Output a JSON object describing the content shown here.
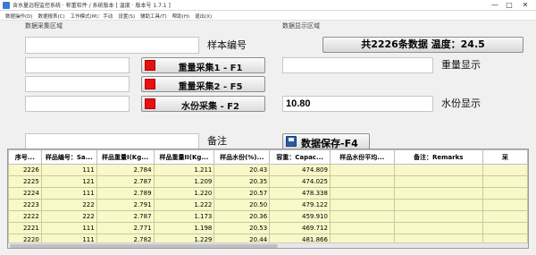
{
  "window": {
    "title": "含水量远程监控系统 · 称重软件 / 系统版本 [ 温度 · 版本号 1.7.1 ]",
    "minimize": "—",
    "maximize": "□",
    "close": "✕"
  },
  "menu": [
    "数据操作(D)",
    "数据报表(C)",
    "工作模式(M)：手动",
    "设置(S)",
    "辅助工具(T)",
    "帮助(H)",
    "退出(X)"
  ],
  "groups": {
    "acquisition": "数据采集区域",
    "display": "数据显示区域"
  },
  "form": {
    "sample_no_label": "样本编号",
    "sample_no_value": "",
    "weight1_value": "",
    "weight2_value": "",
    "moisture_value": "",
    "weight_display_label": "重量显示",
    "weight_display_value": "",
    "moisture_display_label": "水份显示",
    "moisture_display_value": "10.80",
    "remark_label": "备注",
    "remark_value": ""
  },
  "buttons": {
    "weigh1": "重量采集1 - F1",
    "weigh2": "重量采集2 - F5",
    "moisture": "水份采集 - F2",
    "save": "数据保存-F4"
  },
  "status": {
    "count_banner": "共2226条数据 温度：24.5"
  },
  "table": {
    "headers": [
      "序号...",
      "样品编号：Sa...",
      "样品重量I(Kg...",
      "样品重量II(Kg...",
      "样品水份(%)...",
      "容重：Capac...",
      "样品水份平均...",
      "备注：Remarks",
      "采"
    ],
    "rows": [
      [
        "2226",
        "111",
        "2.784",
        "1.211",
        "20.43",
        "474.809",
        "",
        "",
        ""
      ],
      [
        "2225",
        "121",
        "2.787",
        "1.209",
        "20.35",
        "474.025",
        "",
        "",
        ""
      ],
      [
        "2224",
        "111",
        "2.789",
        "1.220",
        "20.57",
        "478.338",
        "",
        "",
        ""
      ],
      [
        "2223",
        "222",
        "2.791",
        "1.222",
        "20.50",
        "479.122",
        "",
        "",
        ""
      ],
      [
        "2222",
        "222",
        "2.787",
        "1.173",
        "20.36",
        "459.910",
        "",
        "",
        ""
      ],
      [
        "2221",
        "111",
        "2.771",
        "1.198",
        "20.53",
        "469.712",
        "",
        "",
        ""
      ],
      [
        "2220",
        "111",
        "2.782",
        "1.229",
        "20.44",
        "481.866",
        "",
        "",
        ""
      ]
    ]
  }
}
